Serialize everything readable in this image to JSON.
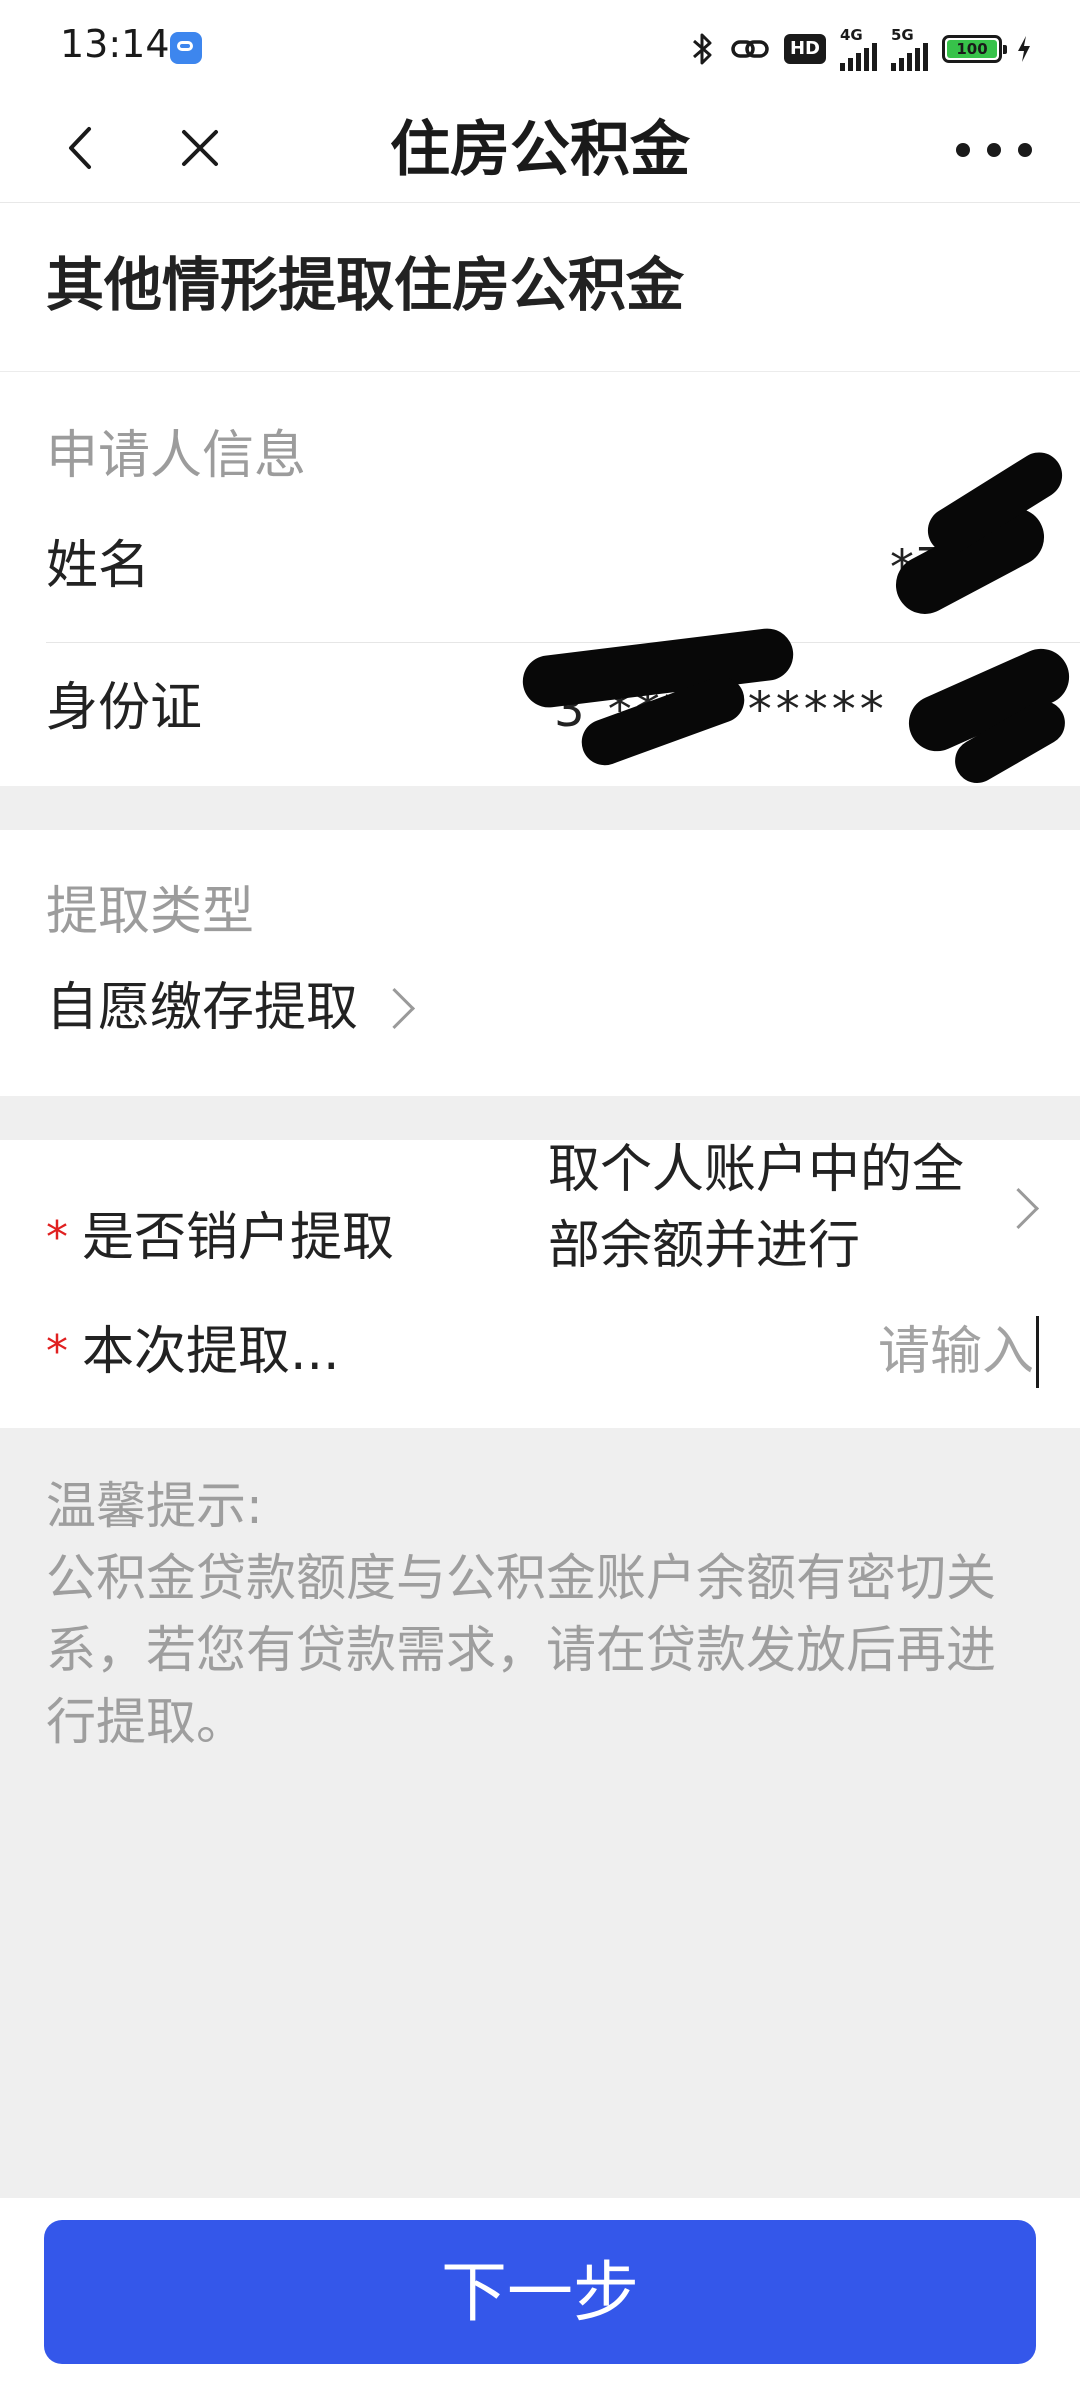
{
  "status_bar": {
    "time": "13:14",
    "network_4g": "4G",
    "network_5g": "5G",
    "hd_label": "HD",
    "battery": "100"
  },
  "nav": {
    "title": "住房公积金",
    "back_icon": "chevron-left-icon",
    "close_icon": "close-icon",
    "more_icon": "more-icon"
  },
  "page": {
    "title": "其他情形提取住房公积金"
  },
  "applicant": {
    "section_label": "申请人信息",
    "name_label": "姓名",
    "name_value": "*王*",
    "id_label": "身份证",
    "id_value": "3 **********"
  },
  "withdraw_type": {
    "label": "提取类型",
    "value": "自愿缴存提取"
  },
  "form": {
    "close_account_label": "是否销户提取",
    "close_account_value": "取个人账户中的全部余额并进行",
    "amount_label": "本次提取...",
    "amount_placeholder": "请输入",
    "required_mark": "*"
  },
  "tip": {
    "title": "温馨提示:",
    "text": "公积金贷款额度与公积金账户余额有密切关系，若您有贷款需求，请在贷款发放后再进行提取。"
  },
  "footer": {
    "next_button": "下一步"
  },
  "colors": {
    "primary": "#3457ea",
    "required": "#e02020",
    "muted": "#9c9c9c",
    "background": "#efefef"
  }
}
